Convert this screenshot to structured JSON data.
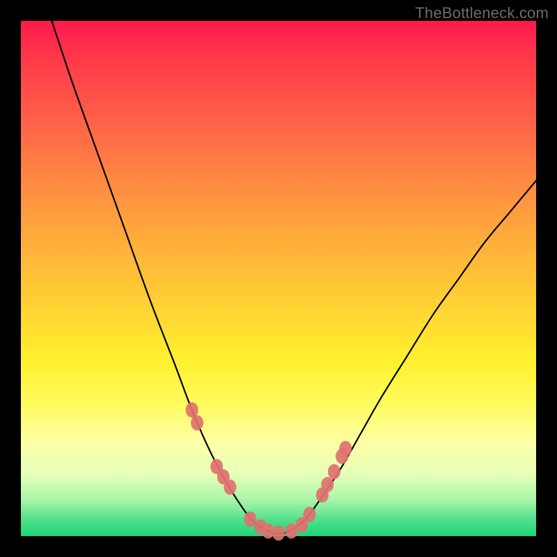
{
  "watermark": "TheBottleneck.com",
  "chart_data": {
    "type": "line",
    "title": "",
    "xlabel": "",
    "ylabel": "",
    "xlim": [
      0,
      100
    ],
    "ylim": [
      0,
      100
    ],
    "series": [
      {
        "name": "curve",
        "x": [
          6,
          10,
          15,
          20,
          25,
          30,
          33,
          36,
          39,
          42,
          45,
          48,
          50,
          52,
          55,
          58,
          62,
          66,
          70,
          75,
          80,
          85,
          90,
          95,
          100
        ],
        "y": [
          100,
          88,
          74,
          60,
          46,
          33,
          25,
          18,
          12,
          7,
          3,
          1,
          0.5,
          1,
          3,
          7,
          13,
          20,
          27,
          35,
          43,
          50,
          57,
          63,
          69
        ]
      }
    ],
    "markers": {
      "name": "dots",
      "color": "#e0716f",
      "x": [
        33.2,
        34.2,
        38.0,
        39.3,
        40.6,
        44.5,
        46.5,
        48.0,
        50.0,
        52.5,
        54.5,
        56.0,
        58.5,
        59.5,
        60.8,
        62.3,
        63.0
      ],
      "y": [
        24.5,
        22.0,
        13.5,
        11.5,
        9.5,
        3.3,
        1.8,
        1.0,
        0.6,
        1.0,
        2.2,
        4.2,
        8.0,
        10.0,
        12.5,
        15.5,
        17.0
      ]
    }
  }
}
